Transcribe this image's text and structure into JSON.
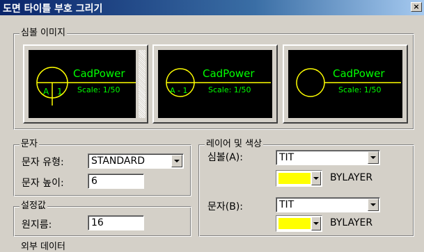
{
  "window": {
    "title": "도면 타이틀 부호 그리기",
    "close_glyph": "×"
  },
  "symbol_image": {
    "legend": "심볼 이미지",
    "previews": [
      {
        "brand": "CadPower",
        "scale": "Scale: 1/50",
        "left_text": "A",
        "right_text": "1"
      },
      {
        "brand": "CadPower",
        "scale": "Scale: 1/50",
        "center_text": "A - 1"
      },
      {
        "brand": "CadPower",
        "scale": "Scale: 1/50"
      }
    ],
    "colors": {
      "line": "#ffff00",
      "text": "#00ff00",
      "background": "#000000"
    }
  },
  "text_group": {
    "legend": "문자",
    "type_label": "문자 유형:",
    "type_value": "STANDARD",
    "height_label": "문자 높이:",
    "height_value": "6"
  },
  "settings_group": {
    "legend": "설정값",
    "radius_label": "원지름:",
    "radius_value": "16"
  },
  "layer_group": {
    "legend": "레이어 및 색상",
    "symbol_label": "심볼(A):",
    "symbol_layer": "TIT",
    "symbol_color_label": "BYLAYER",
    "text_label": "문자(B):",
    "text_layer": "TIT",
    "text_color_label": "BYLAYER",
    "swatch_color": "#ffff00"
  },
  "partial_bottom": {
    "label": "외부 데이터"
  }
}
